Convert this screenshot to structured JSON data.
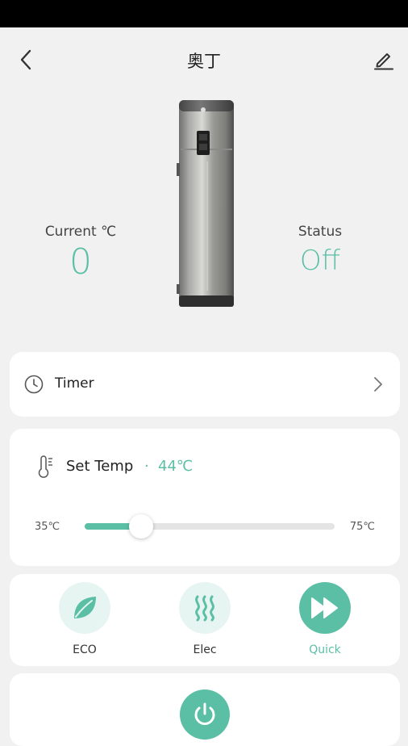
{
  "header": {
    "title": "奥丁"
  },
  "status": {
    "current_label": "Current ℃",
    "current_value": "0",
    "status_label": "Status",
    "status_value": "Off"
  },
  "timer": {
    "label": "Timer"
  },
  "temperature": {
    "label": "Set Temp",
    "separator": "·",
    "value": "44℃",
    "min_label": "35℃",
    "max_label": "75℃",
    "min": 35,
    "max": 75,
    "setpoint": 44
  },
  "modes": [
    {
      "label": "ECO",
      "icon": "leaf-icon",
      "active": false
    },
    {
      "label": "Elec",
      "icon": "heat-waves-icon",
      "active": false
    },
    {
      "label": "Quick",
      "icon": "fast-forward-icon",
      "active": true
    }
  ],
  "colors": {
    "accent": "#5bbfa6",
    "accent_light": "#e7f5f2",
    "background": "#f1f1f1",
    "card": "#ffffff"
  }
}
